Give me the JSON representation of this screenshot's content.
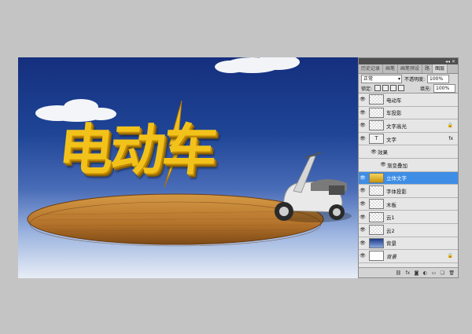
{
  "canvas": {
    "art_title": "电动车"
  },
  "panel": {
    "collapse_label": "◂◂ ✕",
    "tabs": [
      "历史记录",
      "画笔",
      "画笔预设",
      "路",
      "图层"
    ],
    "blend_mode": "正常",
    "opacity_label": "不透明度:",
    "opacity_value": "100%",
    "lock_label": "锁定:",
    "fill_label": "填充:",
    "fill_value": "100%",
    "layers": [
      {
        "name": "电动车",
        "thumb": "checker"
      },
      {
        "name": "车投影",
        "thumb": "checker"
      },
      {
        "name": "文字高光",
        "thumb": "checker",
        "badge": "lock-icon"
      },
      {
        "name": "文字",
        "thumb": "text",
        "thumb_glyph": "T",
        "badge": "fx"
      },
      {
        "name": "效果",
        "type": "effect-group"
      },
      {
        "name": "渐变叠加",
        "type": "effect"
      },
      {
        "name": "立体文字",
        "thumb": "gold",
        "selected": true
      },
      {
        "name": "字体投影",
        "thumb": "checker"
      },
      {
        "name": "木板",
        "thumb": "checker"
      },
      {
        "name": "云1",
        "thumb": "checker"
      },
      {
        "name": "云2",
        "thumb": "checker"
      },
      {
        "name": "背景",
        "thumb": "blue"
      },
      {
        "name": "背景",
        "thumb": "white",
        "badge": "lock-icon",
        "italic": true
      }
    ],
    "bottom_icons": [
      "link-icon",
      "fx-icon",
      "mask-icon",
      "adjustment-icon",
      "group-icon",
      "new-layer-icon",
      "trash-icon"
    ],
    "bottom_glyphs": [
      "⛓",
      "fx",
      "◙",
      "◐",
      "▭",
      "❏",
      "🗑"
    ],
    "fx_badge": "fx",
    "lock_glyph": "🔒"
  }
}
